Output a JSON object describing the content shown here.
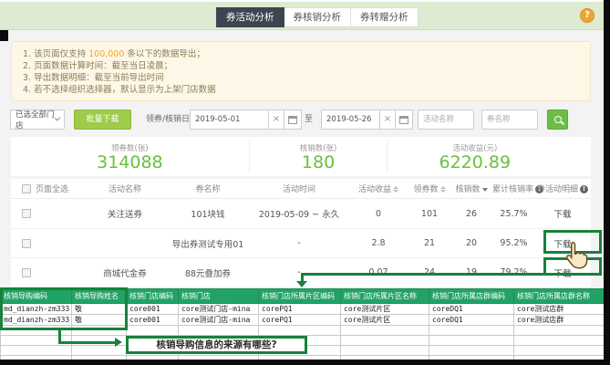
{
  "header": {
    "tabs": [
      {
        "label": "券活动分析",
        "active": true
      },
      {
        "label": "券核销分析",
        "active": false
      },
      {
        "label": "券转赠分析",
        "active": false
      }
    ],
    "help_glyph": "?"
  },
  "notice": {
    "line1_prefix": "1. 该页面仅支持 ",
    "line1_highlight": "100,000",
    "line1_suffix": " 条以下的数据导出；",
    "line2": "2. 页面数据计算时间：截至当日凌晨；",
    "line3": "3. 导出数据明细：截至当前导出时间",
    "line4": "4. 若不选择组织选择器，默认显示为上架门店数据"
  },
  "filters": {
    "store_select": "已选全部门店",
    "batch_download": "批量下载",
    "date_label": "领券/核销日期",
    "date_start": "2019-05-01",
    "date_end": "2019-05-26",
    "to_label": "至",
    "clear_glyph": "×",
    "activity_placeholder": "活动名称",
    "coupon_placeholder": "券名称"
  },
  "stats": [
    {
      "label": "领券数(张)",
      "value": "314088"
    },
    {
      "label": "核销数(张)",
      "value": "180"
    },
    {
      "label": "活动收益(元)",
      "value": "6220.89"
    }
  ],
  "table": {
    "select_all_label": "页面全选",
    "headers": [
      "活动名称",
      "券名称",
      "活动时间",
      "活动收益",
      "领券数",
      "核销数",
      "累计核销率",
      "券活动明细"
    ],
    "info_glyph": "!",
    "download_label": "下载",
    "rows": [
      {
        "activity": "关注送券",
        "coupon": "101块钱",
        "time": "2019-05-09 ~ 永久",
        "revenue": "0",
        "received": "101",
        "redeemed": "26",
        "rate": "25.7%"
      },
      {
        "activity": "",
        "coupon": "导出券测试专用01",
        "time": "-",
        "revenue": "2.8",
        "received": "21",
        "redeemed": "20",
        "rate": "95.2%"
      },
      {
        "activity": "商城代金券",
        "coupon": "88元叠加券",
        "time": "-",
        "revenue": "0.07",
        "received": "24",
        "redeemed": "19",
        "rate": "79.2%"
      }
    ]
  },
  "sheet": {
    "headers": [
      "核销导购编码",
      "核销导购姓名",
      "核销门店编码",
      "核销门店",
      "核销门店所属片区编码",
      "核销门店所属片区名称",
      "核销门店所属店群编码",
      "核销门店所属店群名称"
    ],
    "rows": [
      [
        "md_dianzh-zm333",
        "敬",
        "core001",
        "core测试门店-mina",
        "corePQ1",
        "core测试片区",
        "coreDQ1",
        "core测试店群"
      ],
      [
        "md_dianzh-zm333",
        "敬",
        "core001",
        "core测试门店-mina",
        "corePQ1",
        "core测试片区",
        "coreDQ1",
        "core测试店群"
      ]
    ]
  },
  "annotation": {
    "callout": "核销导购信息的来源有哪些?"
  },
  "colors": {
    "topbar_green": "#dcebd1",
    "tab_active_bg": "#3b4650",
    "notice_bg": "#fdf7e8",
    "highlight_orange": "#f0a431",
    "button_green": "#9ecb4c",
    "search_green": "#6fbe44",
    "stat_green": "#6bbf3f",
    "excel_header_green": "#21a366",
    "annotation_green": "#17823b"
  }
}
